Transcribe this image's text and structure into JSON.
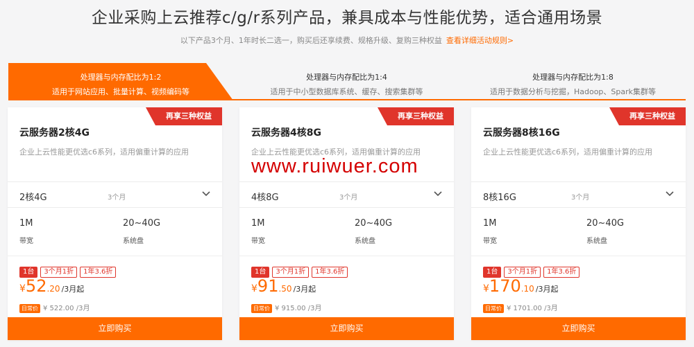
{
  "headline": "企业采购上云推荐c/g/r系列产品，兼具成本与性能优势，适合通用场景",
  "subline": {
    "text": "以下产品3个月、1年时长二选一，购买后还享续费、规格升级、复购三种权益",
    "link": "查看详细活动规则>"
  },
  "tabs": [
    {
      "label": "处理器与内存配比为1:2",
      "sub": "适用于网站应用、批量计算、视频编码等",
      "active": true
    },
    {
      "label": "处理器与内存配比为1:4",
      "sub": "适用于中小型数据库系统、缓存、搜索集群等",
      "active": false
    },
    {
      "label": "处理器与内存配比为1:8",
      "sub": "适用于数据分析与挖掘，Hadoop、Spark集群等",
      "active": false
    }
  ],
  "cards": [
    {
      "ribbon": "再享三种权益",
      "title": "云服务器2核4G",
      "desc": "企业上云性能更优选c6系列，适用偏重计算的应用",
      "spec": "2核4G",
      "period": "3个月",
      "bandwidth": "1M",
      "bandwidth_label": "带宽",
      "disk": "20~40G",
      "disk_label": "系统盘",
      "tags": [
        "1台",
        "3个月1折",
        "1年3.6折"
      ],
      "price_yen": "¥",
      "price_int": "52",
      "price_dec": ".20",
      "price_unit": "/3月起",
      "daily_badge": "日常价",
      "daily_price": "¥ 522.00 /3月",
      "buy_label": "立即购买"
    },
    {
      "ribbon": "再享三种权益",
      "title": "云服务器4核8G",
      "desc": "企业上云性能更优选c6系列，适用偏重计算的应用",
      "spec": "4核8G",
      "period": "3个月",
      "bandwidth": "1M",
      "bandwidth_label": "带宽",
      "disk": "20~40G",
      "disk_label": "系统盘",
      "tags": [
        "1台",
        "3个月1折",
        "1年3.6折"
      ],
      "price_yen": "¥",
      "price_int": "91",
      "price_dec": ".50",
      "price_unit": "/3月起",
      "daily_badge": "日常价",
      "daily_price": "¥ 915.00 /3月",
      "buy_label": "立即购买"
    },
    {
      "ribbon": "再享三种权益",
      "title": "云服务器8核16G",
      "desc": "企业上云性能更优选c6系列，适用偏重计算的应用",
      "spec": "8核16G",
      "period": "3个月",
      "bandwidth": "1M",
      "bandwidth_label": "带宽",
      "disk": "20~40G",
      "disk_label": "系统盘",
      "tags": [
        "1台",
        "3个月1折",
        "1年3.6折"
      ],
      "price_yen": "¥",
      "price_int": "170",
      "price_dec": ".10",
      "price_unit": "/3月起",
      "daily_badge": "日常价",
      "daily_price": "¥ 1701.00 /3月",
      "buy_label": "立即购买"
    }
  ],
  "watermark": "www.ruiwuer.com",
  "colors": {
    "accent": "#ff6a00",
    "ribbon": "#e0352b",
    "background": "#f5f5f6"
  }
}
